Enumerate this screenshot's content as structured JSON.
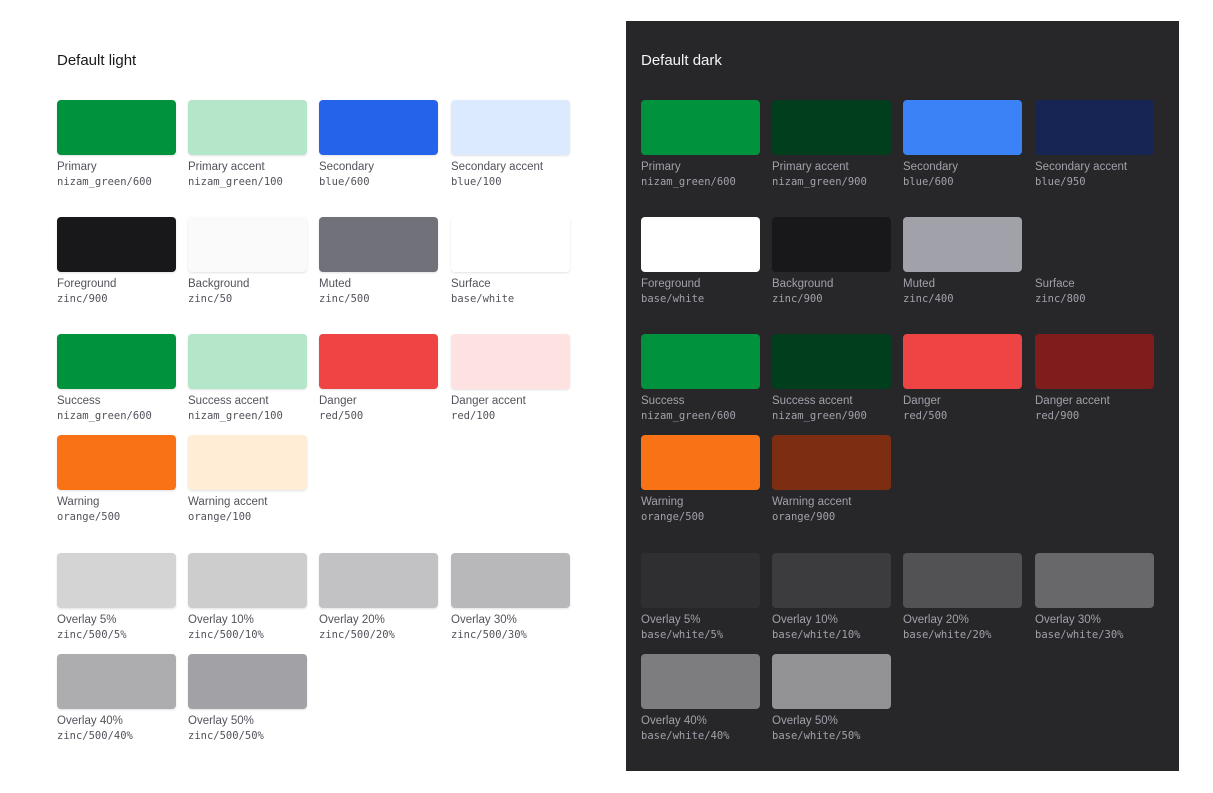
{
  "light": {
    "title": "Default light",
    "swatches": [
      {
        "name": "Primary",
        "token": "nizam_green/600",
        "color": "#00923d"
      },
      {
        "name": "Primary accent",
        "token": "nizam_green/100",
        "color": "#b4e6c9"
      },
      {
        "name": "Secondary",
        "token": "blue/600",
        "color": "#2563eb"
      },
      {
        "name": "Secondary accent",
        "token": "blue/100",
        "color": "#dbeafe"
      },
      {
        "name": "Foreground",
        "token": "zinc/900",
        "color": "#18181b"
      },
      {
        "name": "Background",
        "token": "zinc/50",
        "color": "#fafafa"
      },
      {
        "name": "Muted",
        "token": "zinc/500",
        "color": "#71717a"
      },
      {
        "name": "Surface",
        "token": "base/white",
        "color": "#ffffff"
      },
      {
        "name": "Success",
        "token": "nizam_green/600",
        "color": "#00923d"
      },
      {
        "name": "Success accent",
        "token": "nizam_green/100",
        "color": "#b4e6c9"
      },
      {
        "name": "Danger",
        "token": "red/500",
        "color": "#ef4444"
      },
      {
        "name": "Danger accent",
        "token": "red/100",
        "color": "#fee2e2"
      },
      {
        "name": "Warning",
        "token": "orange/500",
        "color": "#f97316"
      },
      {
        "name": "Warning accent",
        "token": "orange/100",
        "color": "#ffedd5"
      },
      {
        "name": "Overlay 5%",
        "token": "zinc/500/5%",
        "color": "#d4d4d5"
      },
      {
        "name": "Overlay 10%",
        "token": "zinc/500/10%",
        "color": "#cdcdce"
      },
      {
        "name": "Overlay 20%",
        "token": "zinc/500/20%",
        "color": "#c2c2c4"
      },
      {
        "name": "Overlay 30%",
        "token": "zinc/500/30%",
        "color": "#b8b8ba"
      },
      {
        "name": "Overlay 40%",
        "token": "zinc/500/40%",
        "color": "#adadb0"
      },
      {
        "name": "Overlay 50%",
        "token": "zinc/500/50%",
        "color": "#a2a2a6"
      }
    ]
  },
  "dark": {
    "title": "Default dark",
    "swatches": [
      {
        "name": "Primary",
        "token": "nizam_green/600",
        "color": "#00923d"
      },
      {
        "name": "Primary accent",
        "token": "nizam_green/900",
        "color": "#003e1d"
      },
      {
        "name": "Secondary",
        "token": "blue/600",
        "color": "#3b82f6"
      },
      {
        "name": "Secondary accent",
        "token": "blue/950",
        "color": "#172554"
      },
      {
        "name": "Foreground",
        "token": "base/white",
        "color": "#ffffff"
      },
      {
        "name": "Background",
        "token": "zinc/900",
        "color": "#18181b"
      },
      {
        "name": "Muted",
        "token": "zinc/400",
        "color": "#a1a1aa"
      },
      {
        "name": "Surface",
        "token": "zinc/800",
        "color": "#27272a"
      },
      {
        "name": "Success",
        "token": "nizam_green/600",
        "color": "#00923d"
      },
      {
        "name": "Success accent",
        "token": "nizam_green/900",
        "color": "#003e1d"
      },
      {
        "name": "Danger",
        "token": "red/500",
        "color": "#ef4444"
      },
      {
        "name": "Danger accent",
        "token": "red/900",
        "color": "#7f1d1d"
      },
      {
        "name": "Warning",
        "token": "orange/500",
        "color": "#f97316"
      },
      {
        "name": "Warning accent",
        "token": "orange/900",
        "color": "#7c2d12"
      },
      {
        "name": "Overlay 5%",
        "token": "base/white/5%",
        "color": "#2f2f32"
      },
      {
        "name": "Overlay 10%",
        "token": "base/white/10%",
        "color": "#3c3c3f"
      },
      {
        "name": "Overlay 20%",
        "token": "base/white/20%",
        "color": "#525255"
      },
      {
        "name": "Overlay 30%",
        "token": "base/white/30%",
        "color": "#68686a"
      },
      {
        "name": "Overlay 40%",
        "token": "base/white/40%",
        "color": "#7d7d7f"
      },
      {
        "name": "Overlay 50%",
        "token": "base/white/50%",
        "color": "#939395"
      }
    ]
  }
}
